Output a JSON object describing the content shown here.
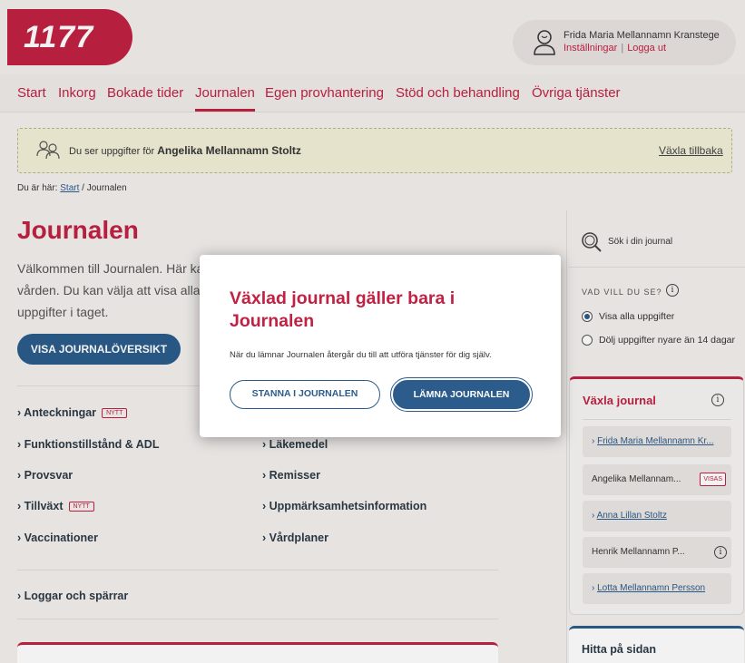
{
  "header": {
    "logo": "1177",
    "user_name": "Frida Maria Mellannamn Kranstege",
    "settings_link": "Inställningar",
    "logout_link": "Logga ut"
  },
  "nav": {
    "items": [
      "Start",
      "Inkorg",
      "Bokade tider",
      "Journalen",
      "Egen provhantering",
      "Stöd och behandling",
      "Övriga tjänster"
    ],
    "active": "Journalen"
  },
  "banner": {
    "prefix": "Du ser uppgifter för",
    "person": "Angelika Mellannamn Stoltz",
    "switch_back": "Växla tillbaka"
  },
  "breadcrumb": {
    "prefix": "Du är här:",
    "start": "Start",
    "current": "/ Journalen"
  },
  "main": {
    "title": "Journalen",
    "intro": "Välkommen till Journalen. Här ka vården. Du kan välja att visa alla typ av uppgifter i taget.",
    "overview_button": "VISA JOURNALÖVERSIKT",
    "new_badge": "NYTT",
    "left_links": [
      "Anteckningar",
      "Funktionstillstånd & ADL",
      "Provsvar",
      "Tillväxt",
      "Vaccinationer"
    ],
    "right_links": [
      "Läkemedel",
      "Remisser",
      "Uppmärksamhetsinformation",
      "Vårdplaner"
    ],
    "log_link": "Loggar och spärrar"
  },
  "sidebar": {
    "search": "Sök i din journal",
    "filter_heading": "VAD VILL DU SE?",
    "options": [
      "Visa alla uppgifter",
      "Dölj uppgifter nyare än 14 dagar"
    ],
    "selected_option": 0,
    "switch_title": "Växla journal",
    "persons": [
      {
        "name": "Frida Maria Mellannamn Kr...",
        "link": true
      },
      {
        "name": "Angelika Mellannam...",
        "badge": "VISAS"
      },
      {
        "name": "Anna Lillan Stoltz",
        "link": true
      },
      {
        "name": "Henrik Mellannamn P...",
        "info": true
      },
      {
        "name": "Lotta Mellannamn Persson",
        "link": true
      }
    ],
    "find_title": "Hitta på sidan"
  },
  "modal": {
    "title": "Växlad journal gäller bara i Journalen",
    "text": "När du lämnar Journalen återgår du till att utföra tjänster för dig själv.",
    "stay_button": "STANNA I JOURNALEN",
    "leave_button": "LÄMNA JOURNALEN"
  },
  "colors": {
    "brand": "#c12143",
    "primary": "#2c5c8c",
    "banner_bg": "#f2f0d7"
  }
}
